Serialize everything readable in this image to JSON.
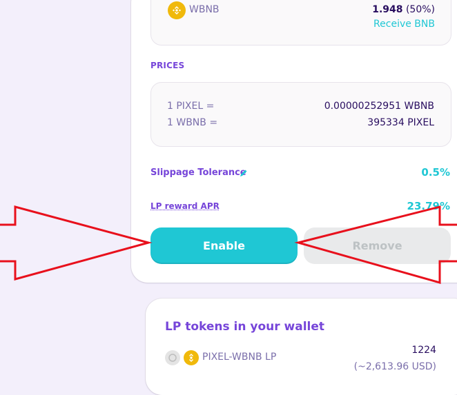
{
  "pool_share": {
    "token": "WBNB",
    "amount": "1.948",
    "percent": "(50%)",
    "receive_link": "Receive BNB"
  },
  "prices": {
    "heading": "PRICES",
    "rows": [
      {
        "label": "1 PIXEL =",
        "value": "0.00000252951 WBNB"
      },
      {
        "label": "1 WBNB =",
        "value": "395334 PIXEL"
      }
    ]
  },
  "slippage": {
    "label": "Slippage Tolerance",
    "value": "0.5%"
  },
  "apr": {
    "label": "LP reward APR",
    "value": "23.79%"
  },
  "buttons": {
    "enable": "Enable",
    "remove": "Remove"
  },
  "wallet": {
    "title": "LP tokens in your wallet",
    "pair": "PIXEL-WBNB LP",
    "amount": "1224",
    "usd": "(~2,613.96 USD)"
  },
  "colors": {
    "primary": "#1fc7d4",
    "secondary": "#7645d9",
    "text": "#280d5f",
    "annotation_arrow": "#e8101c"
  },
  "icons": [
    "bnb-token-icon",
    "pixel-token-icon",
    "pencil-icon"
  ]
}
